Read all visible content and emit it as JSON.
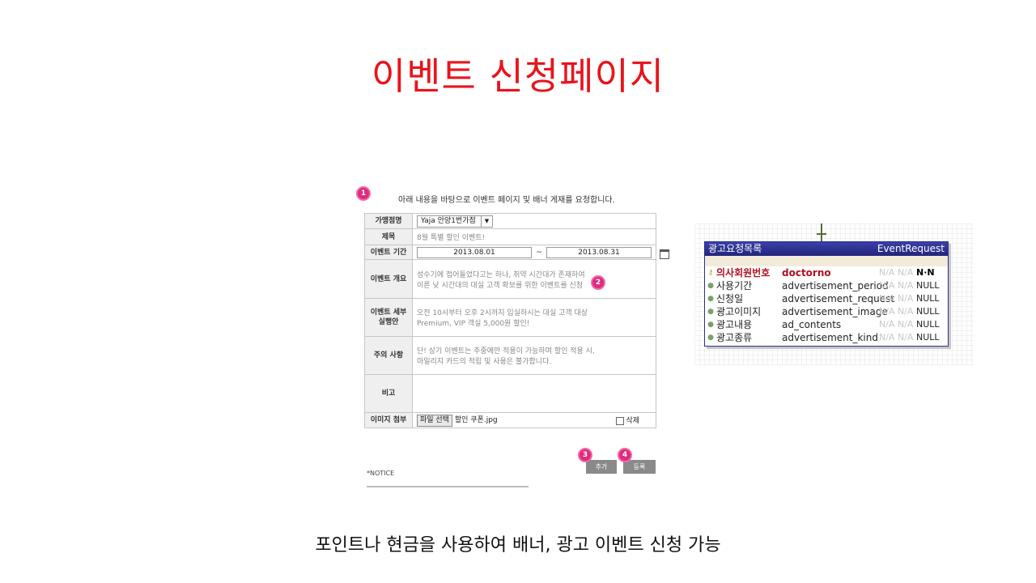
{
  "slide": {
    "title": "이벤트 신청페이지",
    "caption": "포인트나 현금을 사용하여 배너, 광고 이벤트 신청 가능"
  },
  "form": {
    "intro": "아래 내용을 바탕으로 이벤트 페이지 및 배너 게재를 요청합니다.",
    "markers": [
      "1",
      "2",
      "3",
      "4"
    ],
    "rows": {
      "hospital": {
        "label": "가맹점명",
        "value": "Yaja 안양1번가점"
      },
      "title": {
        "label": "제목",
        "value": "8월 특별 할인 이벤트!"
      },
      "period": {
        "label": "이벤트 기간",
        "start": "2013.08.01",
        "sep": "~",
        "end": "2013.08.31"
      },
      "summary": {
        "label": "이벤트 개요",
        "line1": "성수기에 접어들었다고는 하나, 취약 시간대가 존재하여",
        "line2": "이른 낮 시간대의 대실 고객 확보를 위한 이벤트를 신청"
      },
      "detail": {
        "label1": "이벤트 세부",
        "label2": "실행안",
        "line1": "오전 10시부터 오후 2시까지 입실하시는 대실 고객 대상",
        "line2": "Premium, VIP 객실 5,000원 할인!"
      },
      "caution": {
        "label": "주의 사항",
        "line1": "단! 상기 이벤트는 주중에만 적용이 가능하며 할인 적용 시,",
        "line2": "마일리지 카드의 적립 및 사용은 불가합니다."
      },
      "note": {
        "label": "비고",
        "value": ""
      },
      "attach": {
        "label": "이미지 첨부",
        "button": "파일 선택",
        "filename": "할인 쿠폰.jpg",
        "delete": "삭제"
      }
    },
    "buttons": {
      "add": "추가",
      "register": "등록"
    },
    "notice": "*NOTICE"
  },
  "entity": {
    "title_ko": "광고요청목록",
    "title_en": "EventRequest",
    "columns": [
      {
        "ko": "의사회원번호",
        "en": "doctorno",
        "na": "N/A N/A",
        "nullable": "N·N",
        "pk": true
      },
      {
        "ko": "사용기간",
        "en": "advertisement_period",
        "na": "N/A N/A",
        "nullable": "NULL",
        "pk": false
      },
      {
        "ko": "신청일",
        "en": "advertisement_request",
        "na": "N/A N/A",
        "nullable": "NULL",
        "pk": false
      },
      {
        "ko": "광고이미지",
        "en": "advertisement_image",
        "na": "N/A N/A",
        "nullable": "NULL",
        "pk": false
      },
      {
        "ko": "광고내용",
        "en": "ad_contents",
        "na": "N/A N/A",
        "nullable": "NULL",
        "pk": false
      },
      {
        "ko": "광고종류",
        "en": "advertisement_kind",
        "na": "N/A N/A",
        "nullable": "NULL",
        "pk": false
      }
    ]
  },
  "colors": {
    "title": "#e8141c",
    "marker": "#e02a7d",
    "entity_header": "#2b2f8c",
    "pk": "#b01020"
  },
  "icons": [
    "calendar-icon",
    "key-icon",
    "column-dot-icon"
  ]
}
